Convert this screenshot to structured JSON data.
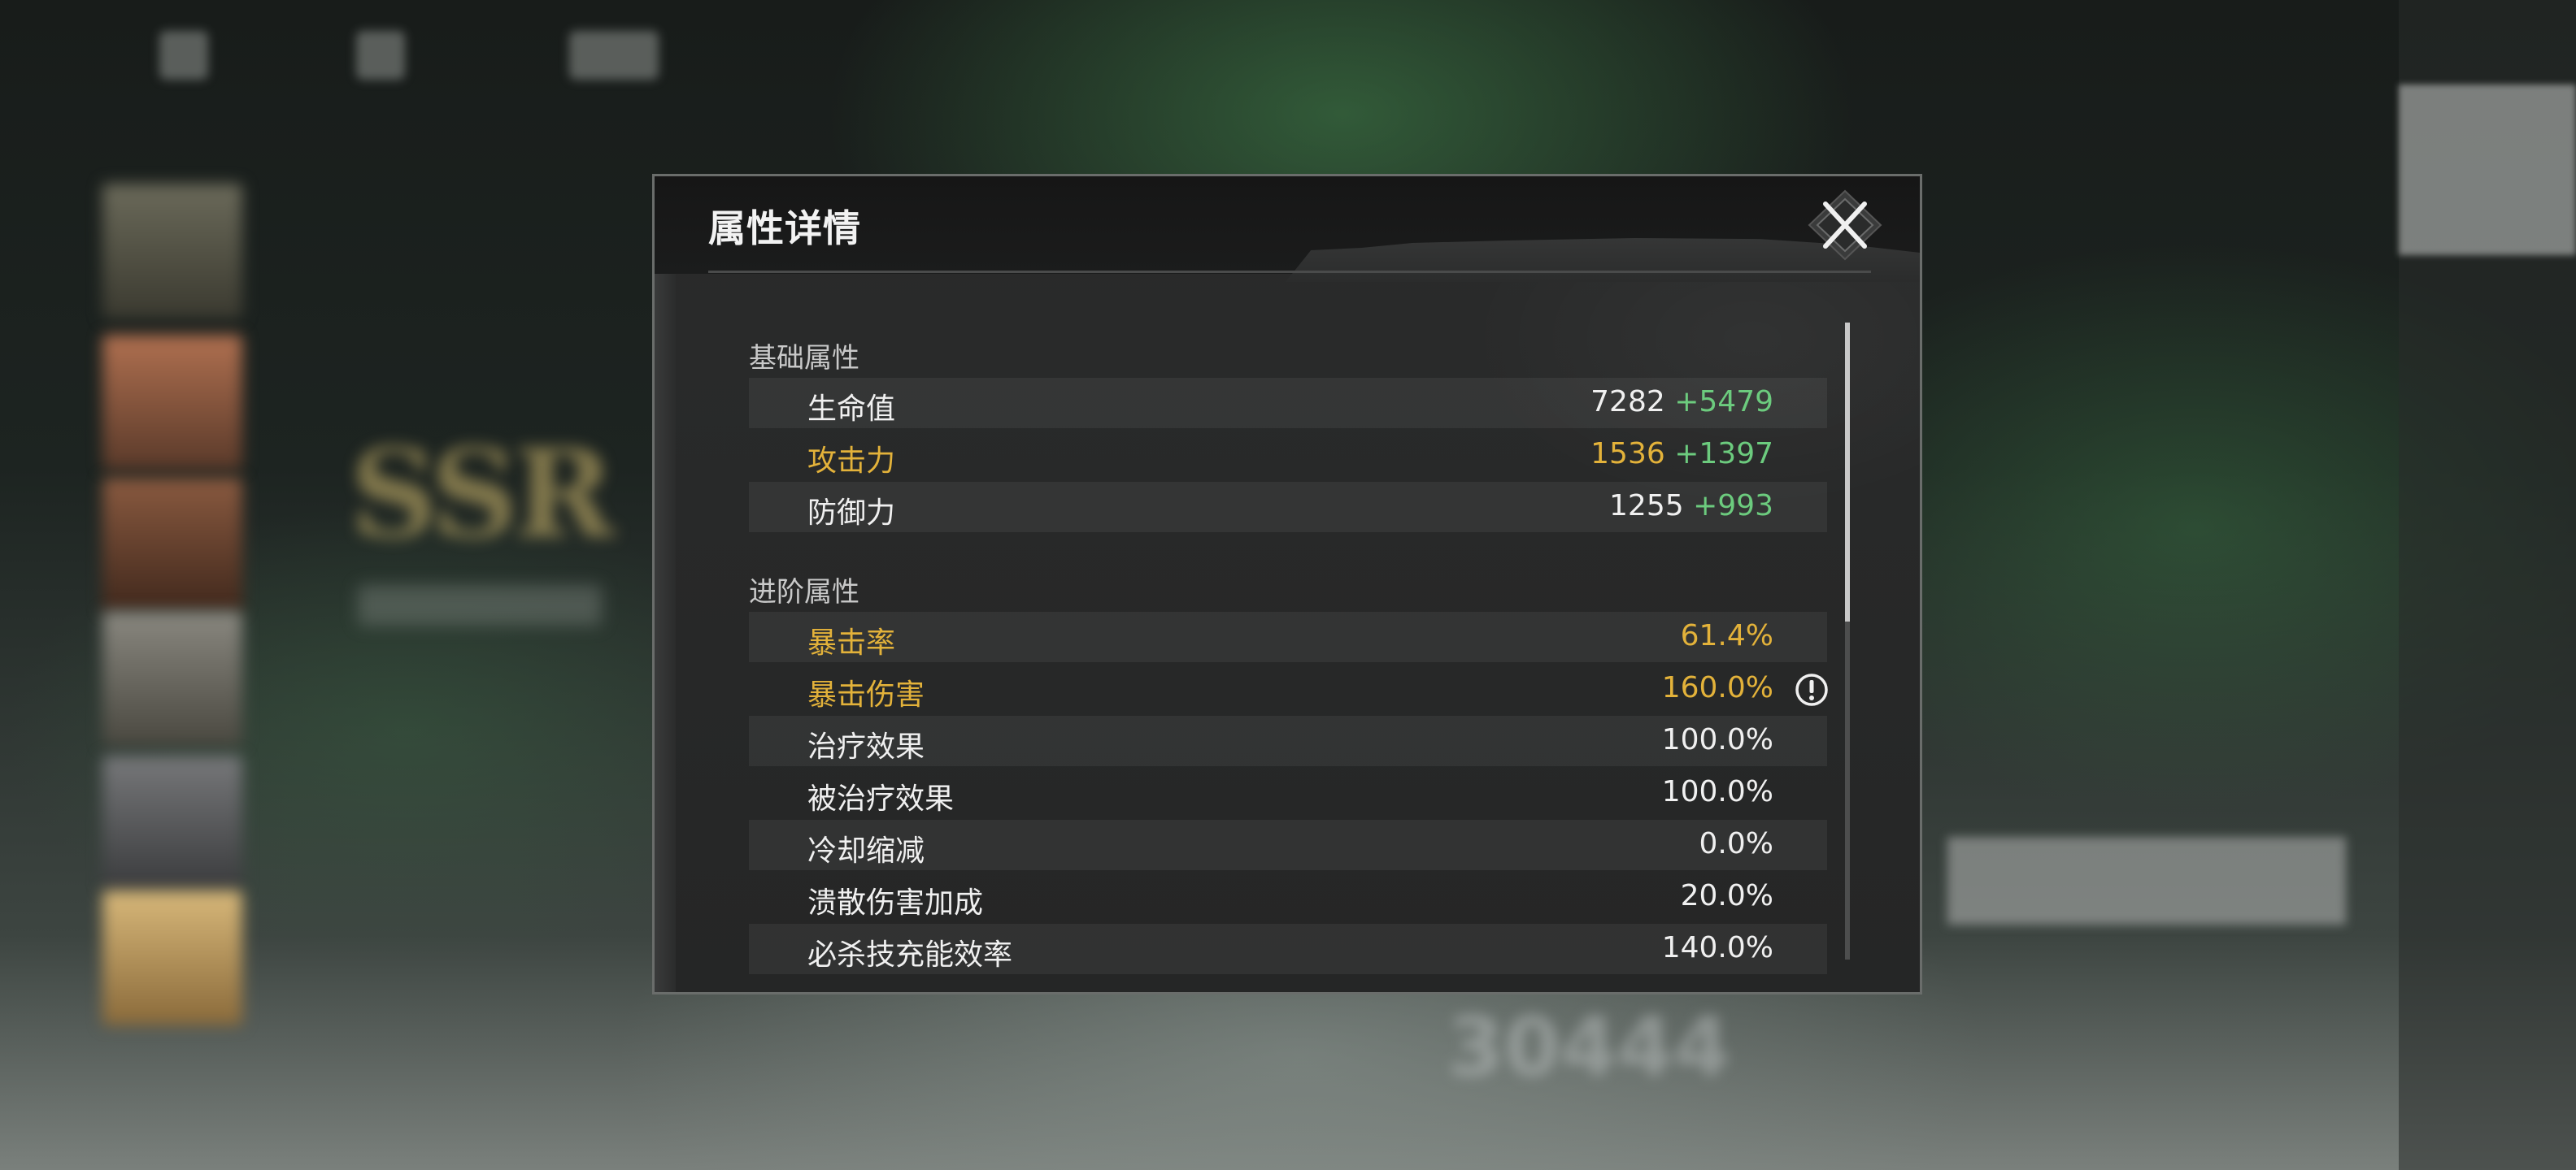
{
  "dialog": {
    "title": "属性详情",
    "close_icon": "close-x-icon"
  },
  "sections": {
    "basic": {
      "title": "基础属性",
      "rows": [
        {
          "label": "生命值",
          "base": "7282",
          "bonus": "+5479",
          "highlight": false
        },
        {
          "label": "攻击力",
          "base": "1536",
          "bonus": "+1397",
          "highlight": true
        },
        {
          "label": "防御力",
          "base": "1255",
          "bonus": "+993",
          "highlight": false
        }
      ]
    },
    "advanced": {
      "title": "进阶属性",
      "rows": [
        {
          "label": "暴击率",
          "value": "61.4%",
          "highlight": true
        },
        {
          "label": "暴击伤害",
          "value": "160.0%",
          "highlight": true,
          "info_icon": "info-exclamation-icon"
        },
        {
          "label": "治疗效果",
          "value": "100.0%",
          "highlight": false
        },
        {
          "label": "被治疗效果",
          "value": "100.0%",
          "highlight": false
        },
        {
          "label": "冷却缩减",
          "value": "0.0%",
          "highlight": false
        },
        {
          "label": "溃散伤害加成",
          "value": "20.0%",
          "highlight": false
        },
        {
          "label": "必杀技充能效率",
          "value": "140.0%",
          "highlight": false
        }
      ]
    }
  },
  "colors": {
    "highlight": "#e3b23a",
    "bonus": "#6ccb7e",
    "text": "#f0f0f0"
  },
  "scroll": {
    "visible_fraction": 0.47
  }
}
